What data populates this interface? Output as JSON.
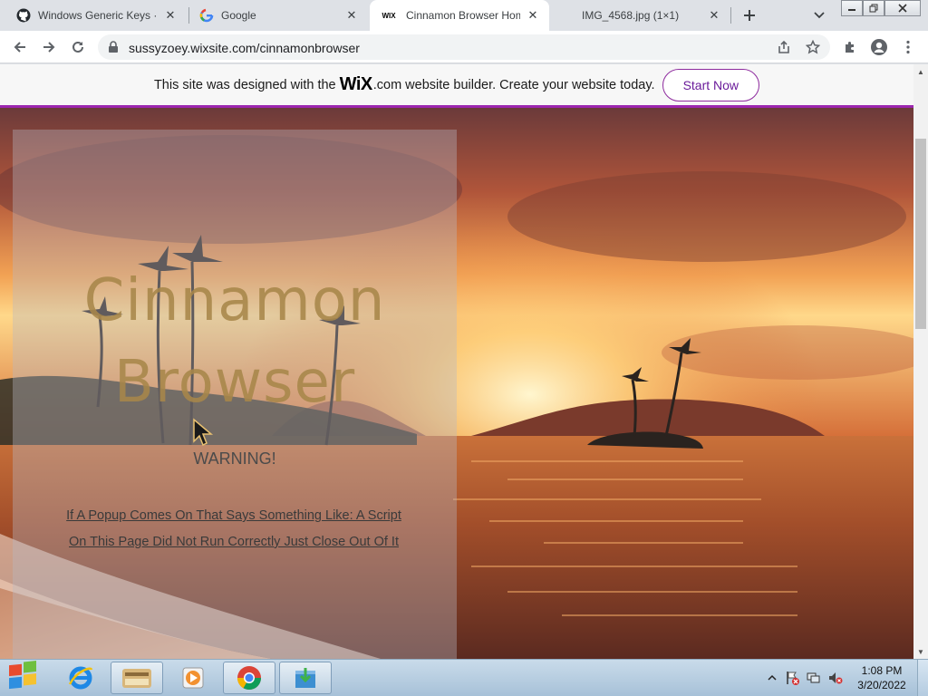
{
  "tabs": [
    {
      "title": "Windows Generic Keys · Gi",
      "icon": "github-icon"
    },
    {
      "title": "Google",
      "icon": "google-icon"
    },
    {
      "title": "Cinnamon Browser Home",
      "icon": "wix-icon",
      "favicon_text": "WIX"
    },
    {
      "title": "IMG_4568.jpg (1×1)",
      "icon": "image-icon"
    }
  ],
  "omnibox": {
    "url": "sussyzoey.wixsite.com/cinnamonbrowser"
  },
  "wix_banner": {
    "prefix": "This site was designed with the",
    "logo_text": "WiX",
    "suffix": ".com website builder. Create your website today.",
    "button": "Start Now",
    "accent": "#9c27b0"
  },
  "hero": {
    "title_line1": "Cinnamon",
    "title_line2": "Browser",
    "warning": "WARNING!",
    "note_line1": "If A Popup Comes On That Says Something Like: A Script",
    "note_line2": "On This Page Did Not Run Correctly Just Close Out Of It"
  },
  "taskbar": {
    "time": "1:08 PM",
    "date": "3/20/2022",
    "pinned": [
      "internet-explorer-icon",
      "file-explorer-icon",
      "media-player-icon",
      "chrome-icon",
      "installer-icon"
    ]
  }
}
